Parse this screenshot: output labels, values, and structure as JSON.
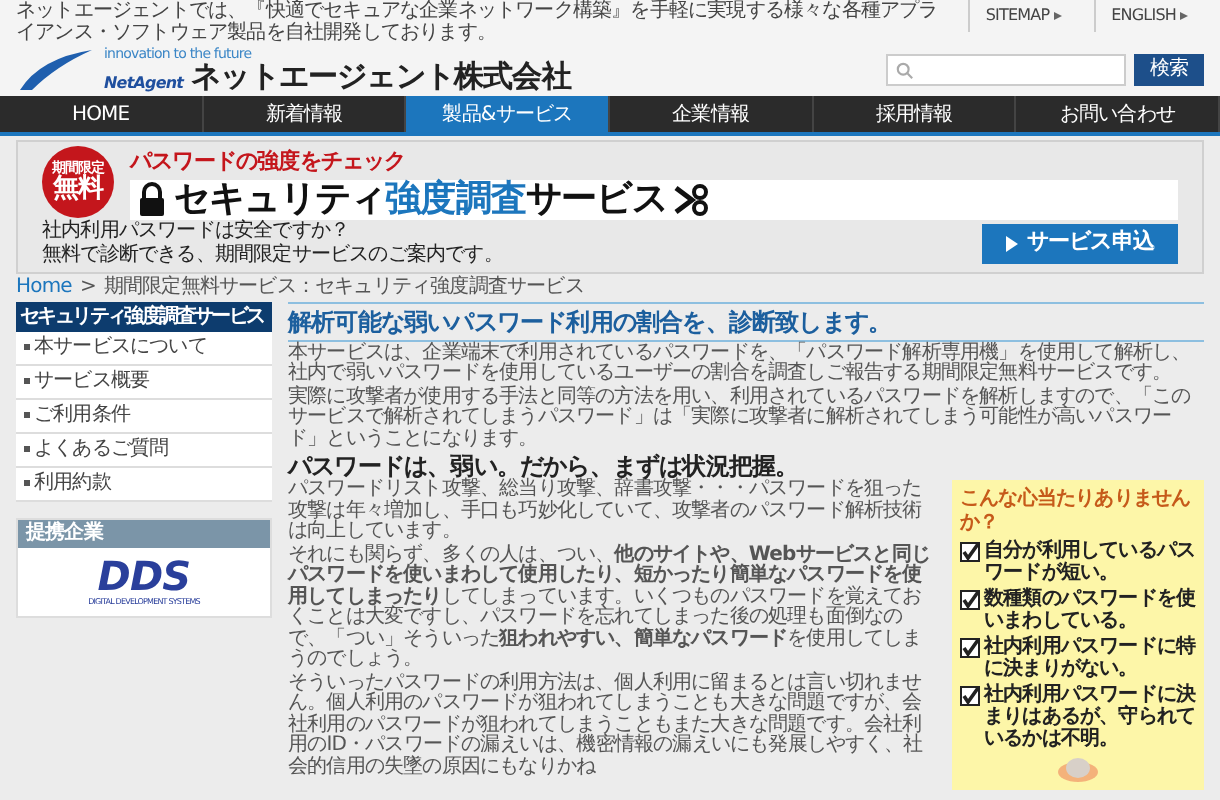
{
  "header": {
    "tagline": "ネットエージェントでは、『快適でセキュアな企業ネットワーク構築』を手軽に実現する様々な各種アプライアンス・ソフトウェア製品を自社開発しております。",
    "logo_mark": "NetAgent",
    "logo_slogan": "innovation to the future",
    "company": "ネットエージェント株式会社",
    "links": [
      "SITEMAP",
      "ENGLISH"
    ],
    "search_button": "検索"
  },
  "nav": [
    {
      "label": "HOME",
      "selected": false
    },
    {
      "label": "新着情報",
      "selected": false
    },
    {
      "label": "製品&サービス",
      "selected": true
    },
    {
      "label": "企業情報",
      "selected": false
    },
    {
      "label": "採用情報",
      "selected": false
    },
    {
      "label": "お問い合わせ",
      "selected": false
    }
  ],
  "banner": {
    "badge_top": "期間限定",
    "badge_main": "無料",
    "subtitle": "パスワードの強度をチェック",
    "title": [
      {
        "text": "セキュリティ",
        "accent": false
      },
      {
        "text": "強度調査",
        "accent": true
      },
      {
        "text": "サービス",
        "accent": false
      }
    ],
    "lines": [
      "社内利用パスワードは安全ですか？",
      "無料で診断できる、期間限定サービスのご案内です。"
    ],
    "button": "サービス申込"
  },
  "breadcrumb": [
    "Home",
    ">",
    "期間限定無料サービス：セキュリティ強度調査サービス"
  ],
  "sidebar": {
    "title": "セキュリティ強度調査サービス",
    "items": [
      "本サービスについて",
      "サービス概要",
      "ご利用条件",
      "よくあるご質問",
      "利用約款"
    ],
    "partner_title": "提携企業",
    "partner_logo": "DDS",
    "partner_name": "DIGITAL DEVELOPMENT SYSTEMS"
  },
  "main": {
    "heading": "解析可能な弱いパスワード利用の割合を、診断致します。",
    "intro": [
      "本サービスは、企業端末で利用されているパスワードを、「パスワード解析専用機」を使用して解析し、社内で弱いパスワードを使用しているユーザーの割合を調査しご報告する期間限定無料サービスです。",
      "実際に攻撃者が使用する手法と同等の方法を用い、利用されているパスワードを解析しますので、「このサービスで解析されてしまうパスワード」は「実際に攻撃者に解析されてしまう可能性が高いパスワード」ということになります。"
    ],
    "subheading": "パスワードは、弱い。だから、まずは状況把握。",
    "paragraphs": [
      "パスワードリスト攻撃、総当り攻撃、辞書攻撃・・・パスワードを狙った攻撃は年々増加し、手口も巧妙化していて、攻撃者のパスワード解析技術は向上しています。",
      "それにも関らず、多くの人は、つい、**他のサイトや、Webサービスと同じパスワードを使いまわして使用したり、短かったり簡単なパスワードを使用してしまったり**してしまっています。いくつものパスワードを覚えておくことは大変ですし、パスワードを忘れてしまった後の処理も面倒なので、「つい」そういった**狙われやすい、簡単なパスワード**を使用してしまうのでしょう。",
      "そういったパスワードの利用方法は、個人利用に留まるとは言い切れません。個人利用のパスワードが狙われてしまうことも大きな問題ですが、会社利用のパスワードが狙われてしまうこともまた大きな問題です。会社利用のID・パスワードの漏えいは、機密情報の漏えいにも発展しやすく、社会的信用の失墜の原因にもなりかね"
    ],
    "checklist": {
      "title": "こんな心当たりありませんか？",
      "items": [
        {
          "text": "自分が利用しているパスワードが短い。",
          "checked": true
        },
        {
          "text": "数種類のパスワードを使いまわしている。",
          "checked": true
        },
        {
          "text": "社内利用パスワードに特に決まりがない。",
          "checked": true
        },
        {
          "text": "社内利用パスワードに決まりはあるが、守られているかは不明。",
          "checked": true
        }
      ]
    }
  }
}
